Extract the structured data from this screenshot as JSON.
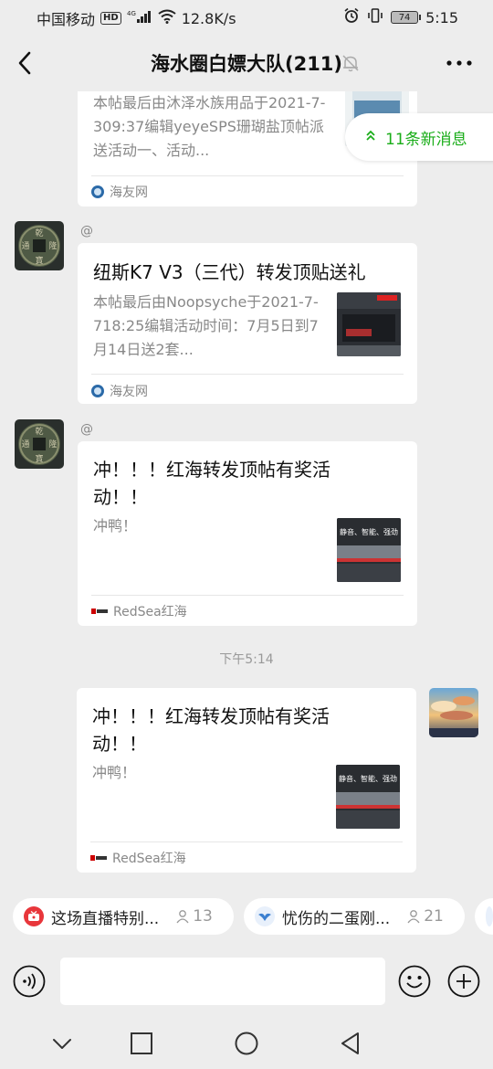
{
  "status_bar": {
    "carrier": "中国移动",
    "hd": "HD",
    "network": "4G",
    "speed": "12.8K/s",
    "battery": "74",
    "time": "5:15"
  },
  "header": {
    "title": "海水圈白嫖大队(211)",
    "back_icon": "back-chevron-icon",
    "mute_icon": "bell-off-icon",
    "more_icon": "more-dots-icon"
  },
  "new_messages": {
    "label": "11条新消息"
  },
  "messages": [
    {
      "type": "card",
      "title": "",
      "desc": "本帖最后由沐泽水族用品于2021-7-309:37编辑yeyeSPS珊瑚盐顶帖派送活动一、活动...",
      "source": "海友网"
    },
    {
      "type": "card",
      "at": "@",
      "title": "纽斯K7 V3（三代）转发顶贴送礼",
      "desc": "本帖最后由Noopsyche于2021-7-718:25编辑活动时间：7月5日到7月14日送2套...",
      "source": "海友网"
    },
    {
      "type": "card",
      "at": "@",
      "title": "冲！！！红海转发顶帖有奖活动！！",
      "desc": "冲鸭！",
      "source": "RedSea红海",
      "thumb_text": "静音、智能、强劲"
    },
    {
      "type": "card",
      "title": "冲！！！红海转发顶帖有奖活动！！",
      "desc": "冲鸭！",
      "source": "RedSea红海",
      "thumb_text": "静音、智能、强劲"
    }
  ],
  "timestamp": "下午5:14",
  "live_chips": [
    {
      "label": "这场直播特别...",
      "count": "13"
    },
    {
      "label": "忧伤的二蛋刚...",
      "count": "21"
    }
  ],
  "colors": {
    "background": "#ededed",
    "accent_green": "#1aad19",
    "card": "#ffffff"
  }
}
